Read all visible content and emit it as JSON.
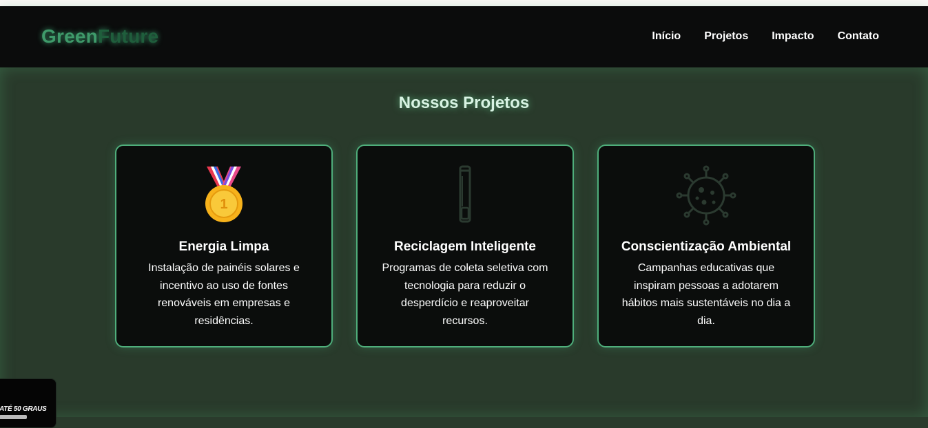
{
  "header": {
    "logo_part1": "Green",
    "logo_part2": "Future",
    "nav": [
      {
        "label": "Início"
      },
      {
        "label": "Projetos"
      },
      {
        "label": "Impacto"
      },
      {
        "label": "Contato"
      }
    ]
  },
  "main": {
    "title": "Nossos Projetos",
    "cards": [
      {
        "icon": "medal-icon",
        "title": "Energia Limpa",
        "text": "Instalação de painéis solares e incentivo ao uso de fontes renováveis em empresas e residências."
      },
      {
        "icon": "battery-tube-icon",
        "title": "Reciclagem Inteligente",
        "text": "Programas de coleta seletiva com tecnologia para reduzir o desperdício e reaproveitar recursos."
      },
      {
        "icon": "virus-icon",
        "title": "Conscientização Ambiental",
        "text": "Campanhas educativas que inspiram pessoas a adotarem hábitos mais sustentáveis no dia a dia."
      }
    ]
  },
  "overlay": {
    "badge_text": "ATÉ 50 GRAUS"
  },
  "colors": {
    "accent": "#4fae7b",
    "logo_green": "#3f9a6a",
    "logo_future": "#1f5e3c",
    "card_bg": "#0b0d0c",
    "page_bg": "#293a2b",
    "nav_bg": "#0b0c0c"
  }
}
